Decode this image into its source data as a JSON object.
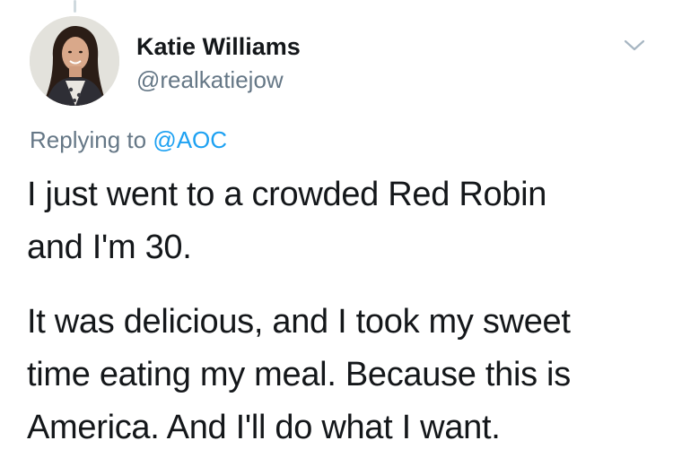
{
  "tweet": {
    "display_name": "Katie Williams",
    "handle": "@realkatiejow",
    "replying_prefix": "Replying to ",
    "replying_to": "@AOC",
    "paragraph1": [
      "I just went to a crowded Red Robin",
      "and I'm 30."
    ],
    "paragraph2": [
      "It was delicious, and I took my sweet",
      "time eating my meal. Because this is",
      "America. And I'll do what I want."
    ]
  },
  "icons": {
    "avatar": "profile-photo",
    "menu": "chevron-down-icon"
  },
  "colors": {
    "text": "#14171a",
    "secondary": "#657786",
    "link": "#1da1f2",
    "background": "#ffffff"
  }
}
